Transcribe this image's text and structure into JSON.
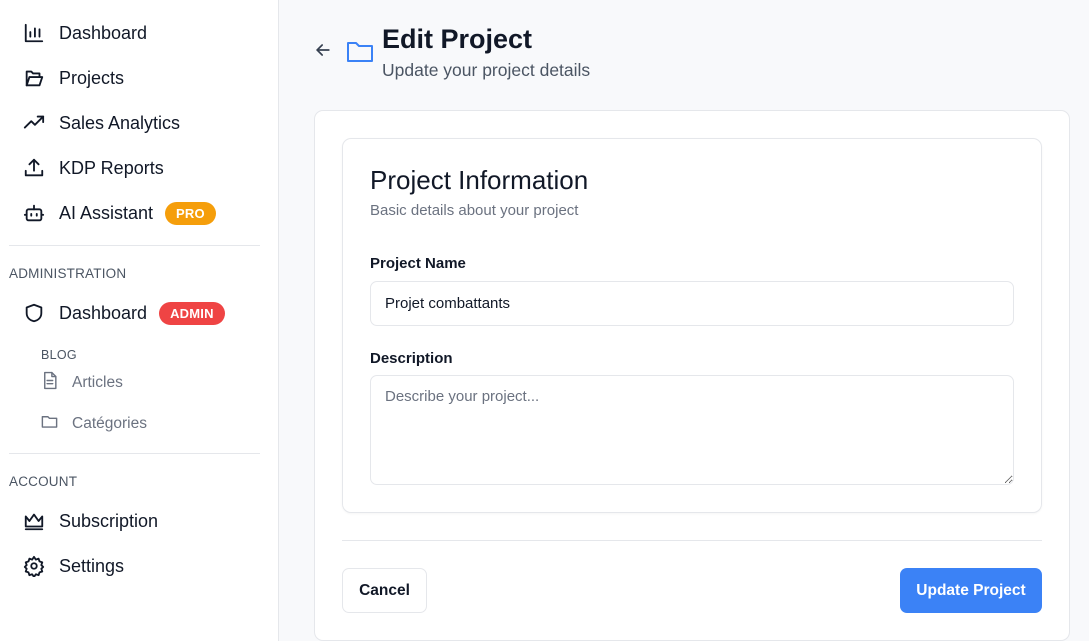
{
  "sidebar": {
    "main_items": [
      {
        "label": "Dashboard",
        "icon": "bar-chart-icon"
      },
      {
        "label": "Projects",
        "icon": "folder-open-icon"
      },
      {
        "label": "Sales Analytics",
        "icon": "trending-up-icon"
      },
      {
        "label": "KDP Reports",
        "icon": "upload-icon"
      },
      {
        "label": "AI Assistant",
        "icon": "bot-icon",
        "badge": "PRO"
      }
    ],
    "administration": {
      "title": "ADMINISTRATION",
      "dashboard": {
        "label": "Dashboard",
        "icon": "shield-icon",
        "badge": "ADMIN"
      },
      "blog": {
        "title": "BLOG",
        "items": [
          {
            "label": "Articles",
            "icon": "file-text-icon"
          },
          {
            "label": "Catégories",
            "icon": "folder-icon"
          }
        ]
      }
    },
    "account": {
      "title": "ACCOUNT",
      "items": [
        {
          "label": "Subscription",
          "icon": "crown-icon"
        },
        {
          "label": "Settings",
          "icon": "gear-icon"
        }
      ]
    }
  },
  "header": {
    "title": "Edit Project",
    "subtitle": "Update your project details"
  },
  "form": {
    "card_title": "Project Information",
    "card_description": "Basic details about your project",
    "name_label": "Project Name",
    "name_value": "Projet combattants",
    "description_label": "Description",
    "description_placeholder": "Describe your project...",
    "description_value": ""
  },
  "actions": {
    "cancel_label": "Cancel",
    "update_label": "Update Project"
  },
  "colors": {
    "accent": "#3b82f6",
    "pro_badge": "#f59e0b",
    "admin_badge": "#ef4444"
  }
}
